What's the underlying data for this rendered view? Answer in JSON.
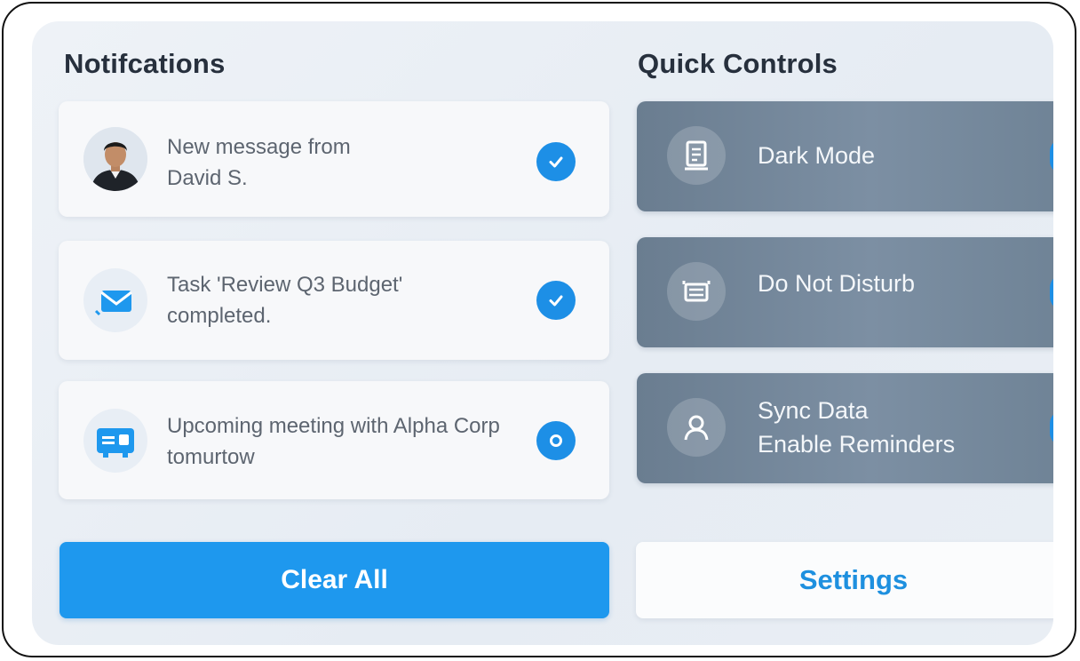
{
  "notifications": {
    "title": "Notifcations",
    "items": [
      {
        "text": "New message from David S.",
        "status": "read",
        "icon": "user-avatar"
      },
      {
        "text": "Task 'Review Q3 Budget' completed.",
        "status": "read",
        "icon": "mail-check-icon"
      },
      {
        "text": "Upcoming meeting with Alpha Corp tomurtow",
        "status": "unread",
        "icon": "calendar-card-icon"
      }
    ],
    "clear_label": "Clear All"
  },
  "quick_controls": {
    "title": "Quick Controls",
    "items": [
      {
        "label": "Dark Mode",
        "icon": "document-icon"
      },
      {
        "label": "Do Not Disturb",
        "icon": "tray-icon"
      },
      {
        "label_line1": "Sync Data",
        "label_line2": "Enable Reminders",
        "icon": "user-icon"
      }
    ],
    "settings_label": "Settings"
  },
  "colors": {
    "accent": "#1e98ee",
    "control_card": "#75889b",
    "panel_bg": "#eaeff5"
  }
}
